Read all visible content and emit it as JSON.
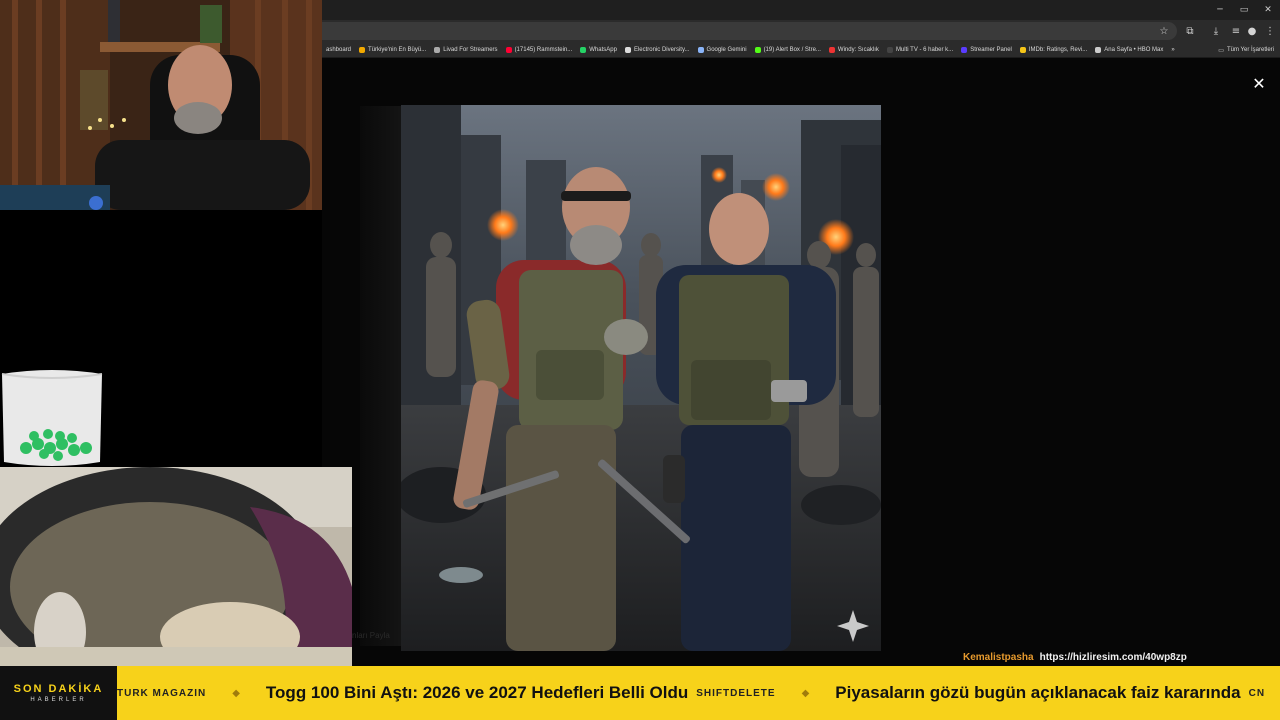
{
  "browser": {
    "window_controls": {
      "minimize": "─",
      "maximize": "▭",
      "close": "✕"
    },
    "toolbar_icons": [
      "star-icon",
      "extension-icon",
      "download-icon",
      "profile-icon",
      "menu-icon"
    ],
    "bookmarks": [
      {
        "label": "ashboard",
        "color": "#888888"
      },
      {
        "label": "Türkiye'nin En Büyü...",
        "color": "#f2a900"
      },
      {
        "label": "Livad For Streamers",
        "color": "#aaaaaa"
      },
      {
        "label": "(17145) Rammstein...",
        "color": "#ff0033"
      },
      {
        "label": "WhatsApp",
        "color": "#25d366"
      },
      {
        "label": "Electronic Diversity...",
        "color": "#dddddd"
      },
      {
        "label": "Google Gemini",
        "color": "#8ab4f8"
      },
      {
        "label": "(19) Alert Box / Stre...",
        "color": "#53fc18"
      },
      {
        "label": "Windy: Sıcaklık",
        "color": "#e33"
      },
      {
        "label": "Multi TV - 6 haber k...",
        "color": "#444"
      },
      {
        "label": "Streamer Panel",
        "color": "#5a3cff"
      },
      {
        "label": "IMDb: Ratings, Revi...",
        "color": "#f5c518"
      },
      {
        "label": "Ana Sayfa • HBO Max",
        "color": "#cccccc"
      }
    ],
    "bookmarks_overflow": "»",
    "all_bookmarks": "Tüm Yer İşaretleri"
  },
  "viewer": {
    "close_symbol": "✕",
    "ghost_text": "nları Payla"
  },
  "chat": {
    "username": "Kemalistpasha",
    "message": "https://hizliresim.com/40wp8zp"
  },
  "ticker": {
    "brand_title": "SON DAKİKA",
    "brand_subtitle": "HABERLER",
    "items": [
      {
        "source": "TURK MAGAZIN",
        "headline": ""
      },
      {
        "source": "",
        "headline": "Togg 100 Bini Aştı: 2026 ve 2027 Hedefleri Belli Oldu"
      },
      {
        "source": "SHIFTDELETE",
        "headline": ""
      },
      {
        "source": "",
        "headline": "Piyasaların gözü bugün açıklanacak faiz kararında"
      },
      {
        "source": "CN",
        "headline": ""
      }
    ],
    "separator": "◆",
    "accent_color": "#f7d21a"
  }
}
